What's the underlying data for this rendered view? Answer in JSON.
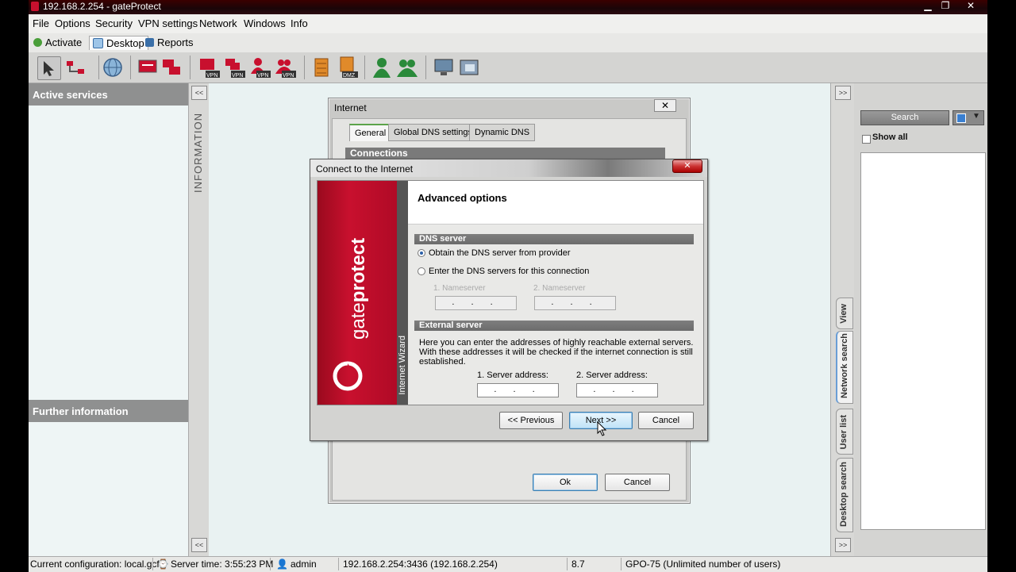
{
  "titlebar": {
    "title": "192.168.2.254 - gateProtect"
  },
  "menu": [
    "File",
    "Options",
    "Security",
    "VPN settings",
    "Network",
    "Windows",
    "Info"
  ],
  "toptabs": [
    {
      "label": "Activate",
      "icon": "gear-icon"
    },
    {
      "label": "Desktop",
      "icon": "desktop-icon"
    },
    {
      "label": "Reports",
      "icon": "reports-icon"
    }
  ],
  "left": {
    "active_services": "Active services",
    "further_information": "Further information",
    "info_label": "INFORMATION"
  },
  "internet_dialog": {
    "title": "Internet",
    "tabs": [
      "General",
      "Global DNS settings",
      "Dynamic DNS"
    ],
    "section": "Connections",
    "ok": "Ok",
    "cancel": "Cancel"
  },
  "wizard": {
    "title": "Connect to the Internet",
    "header": "Advanced options",
    "strip": "Internet Wizard",
    "brand_light": "gate",
    "brand_bold": "protect",
    "dns_section": "DNS server",
    "dns_option1": "Obtain the DNS server from provider",
    "dns_option2": "Enter the DNS servers for this connection",
    "ns1_label": "1. Nameserver",
    "ns2_label": "2. Nameserver",
    "ns1_value": ". . .",
    "ns2_value": ". . .",
    "ext_section": "External server",
    "ext_desc_1": "Here you can enter the addresses of highly reachable external servers.",
    "ext_desc_2": "With these addresses it will be checked if the internet connection is still",
    "ext_desc_3": "established.",
    "srv1_label": "1. Server address:",
    "srv2_label": "2. Server address:",
    "srv1_value": ". . .",
    "srv2_value": ". . .",
    "btn_previous": "<< Previous",
    "btn_next": "Next >>",
    "btn_cancel": "Cancel",
    "selected_option": 1
  },
  "right": {
    "search_label": "Search",
    "show_all": "Show all",
    "vtabs": [
      "View",
      "Network search",
      "User list",
      "Desktop search"
    ],
    "active_vtab": "Network search"
  },
  "status": {
    "config": "Current configuration: local.gcf",
    "server_time": "Server time: 3:55:23 PM",
    "user": "admin",
    "address": "192.168.2.254:3436 (192.168.2.254)",
    "version": "8.7",
    "license": "GPO-75 (Unlimited number of users)"
  },
  "colors": {
    "brand_red": "#c8102e",
    "panel_gray": "#8f9090",
    "focus_blue": "#3c7fb1"
  }
}
